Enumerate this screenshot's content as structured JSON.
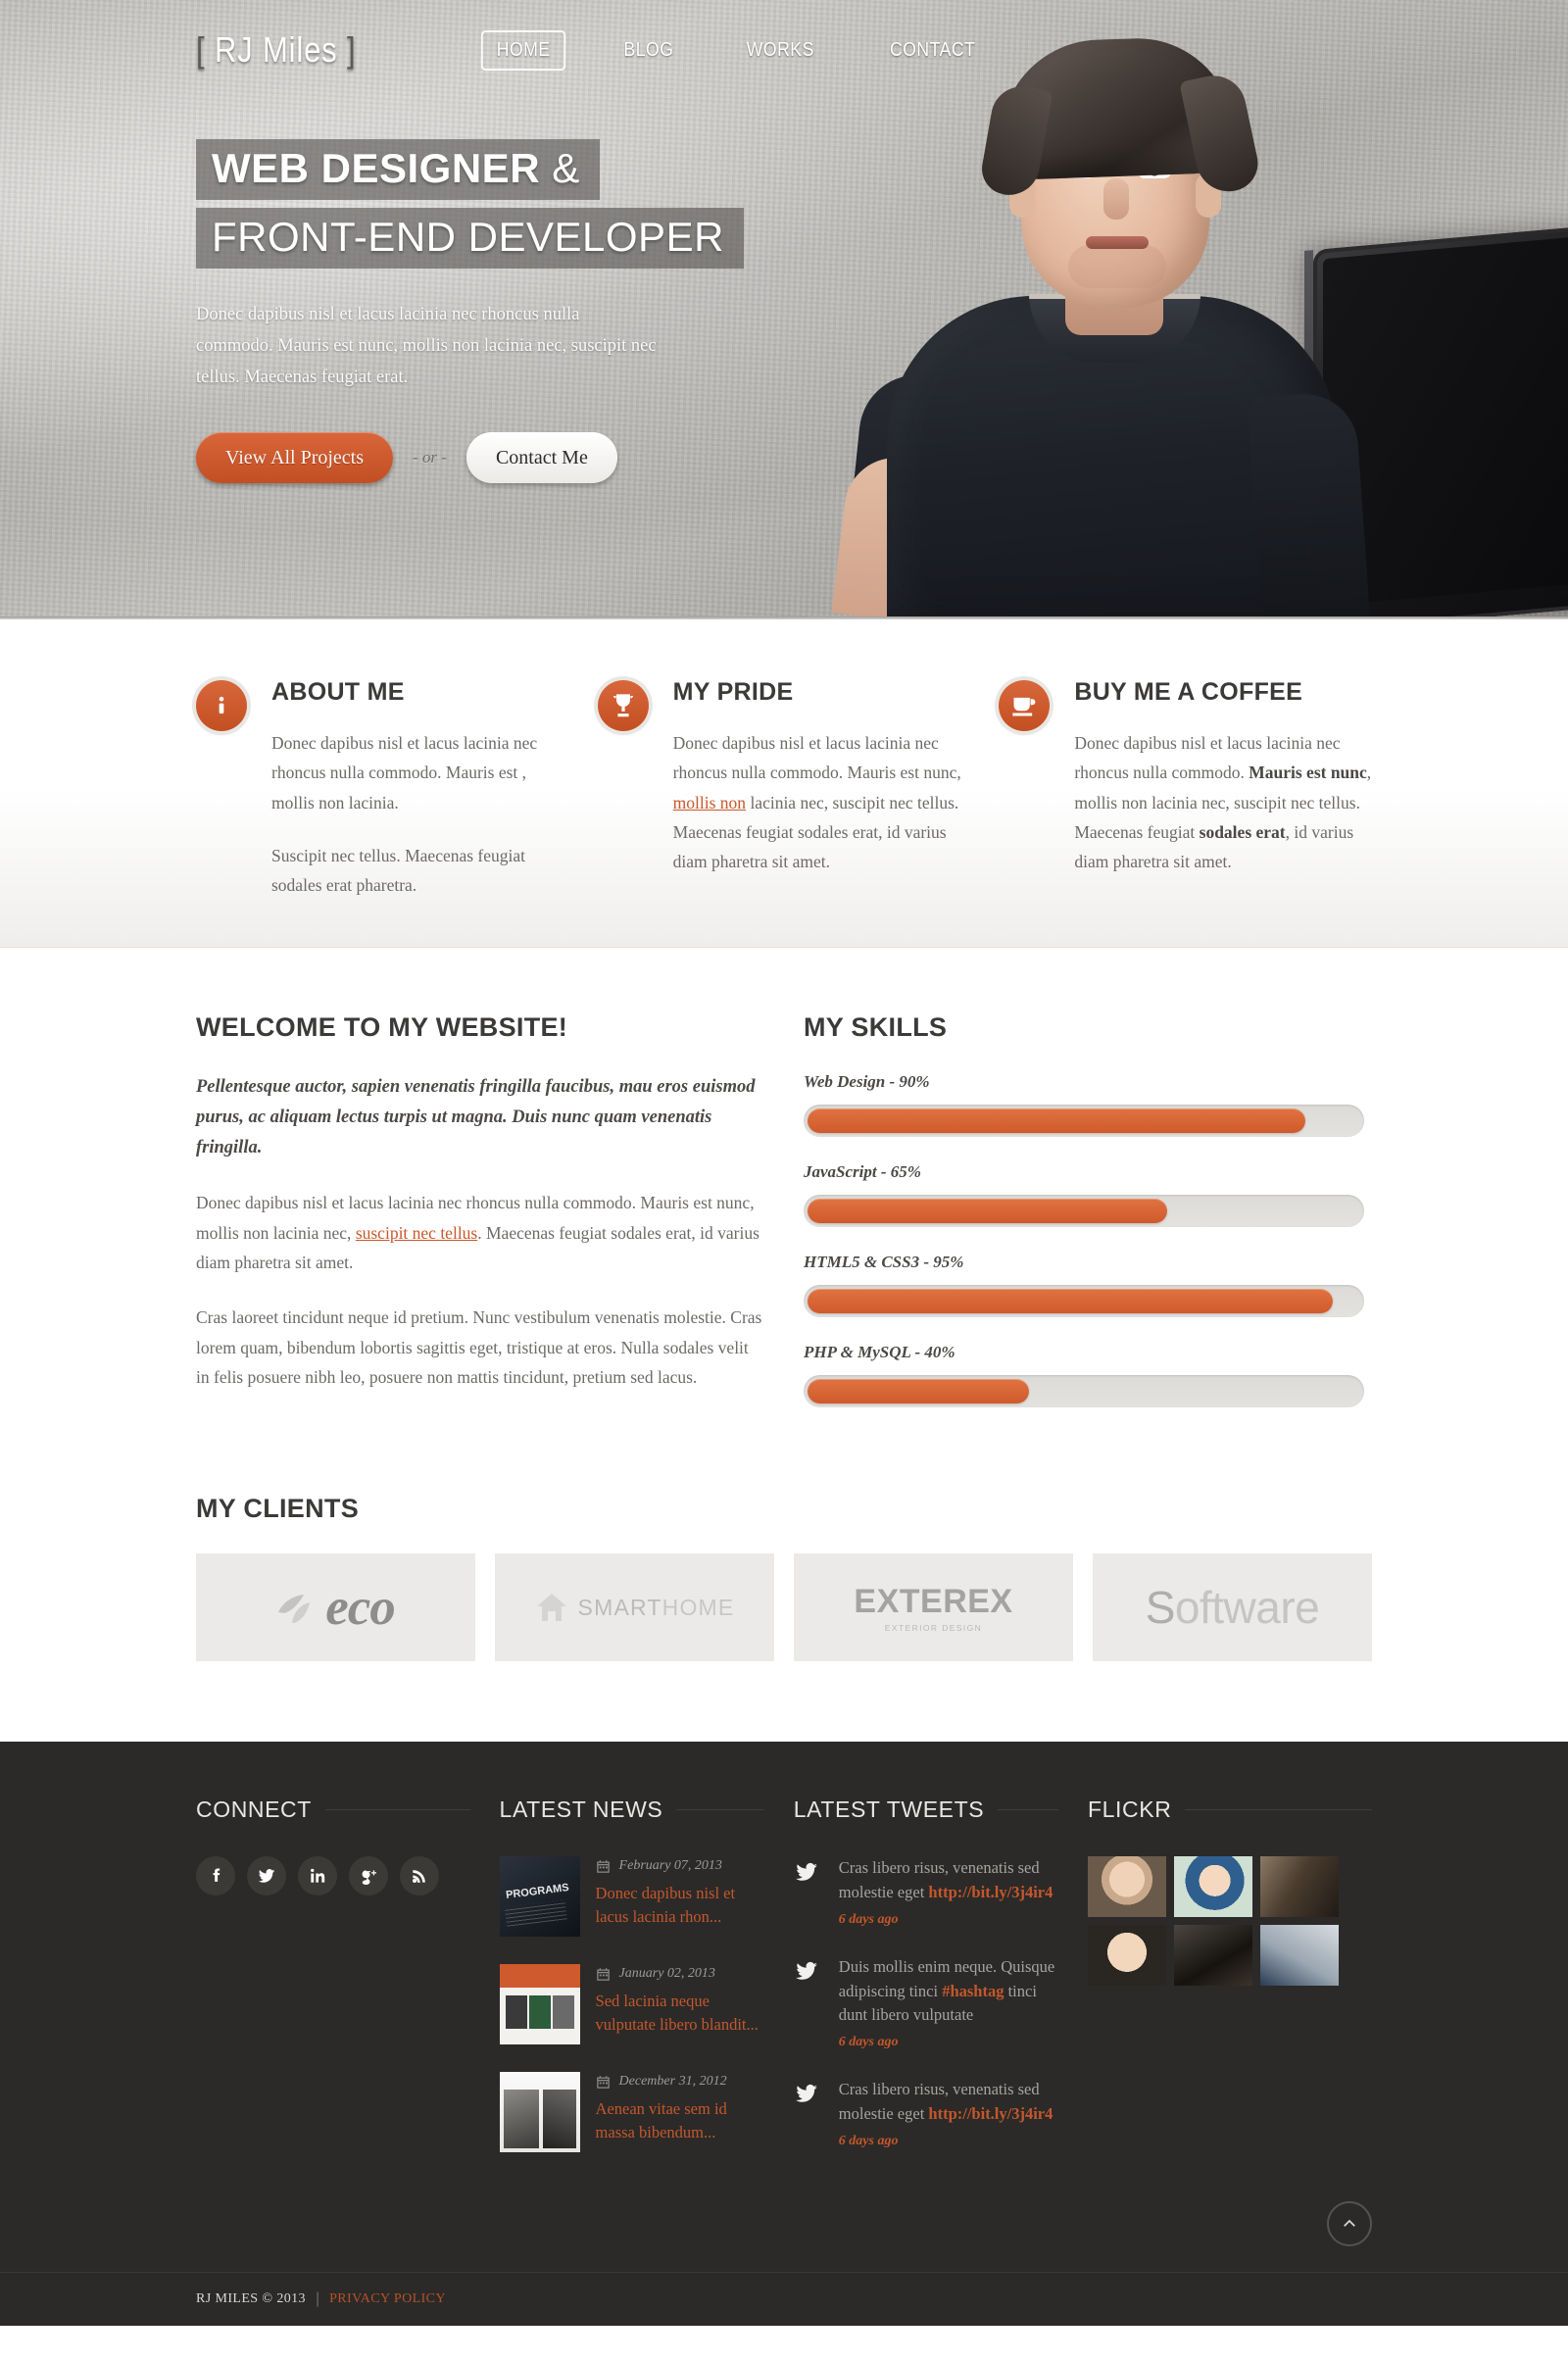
{
  "site": {
    "logo_left_bracket": "[",
    "logo_text": "RJ Miles",
    "logo_right_bracket": "]"
  },
  "nav": {
    "items": [
      {
        "label": "HOME",
        "active": true
      },
      {
        "label": "BLOG",
        "active": false
      },
      {
        "label": "WORKS",
        "active": false
      },
      {
        "label": "CONTACT",
        "active": false
      }
    ]
  },
  "hero": {
    "headline_line1": "WEB DESIGNER",
    "headline_amp": "&",
    "headline_line2": "FRONT-END DEVELOPER",
    "paragraph": "Donec dapibus nisl et lacus lacinia nec rhoncus nulla commodo. Mauris est nunc, mollis non lacinia nec, suscipit nec tellus. Maecenas feugiat erat.",
    "primary_button": "View All Projects",
    "or_text": "- or -",
    "secondary_button": "Contact Me"
  },
  "features": [
    {
      "icon": "info-icon",
      "title": "ABOUT ME",
      "paragraph1_a": "Donec dapibus nisl et lacus lacinia nec rhoncus nulla commodo. Mauris est , mollis non lacinia.",
      "paragraph2": "Suscipit nec tellus. Maecenas feugiat sodales erat pharetra."
    },
    {
      "icon": "trophy-icon",
      "title": "MY PRIDE",
      "paragraph1_a": "Donec dapibus nisl et lacus lacinia nec rhoncus nulla commodo. Mauris est nunc, ",
      "link": "mollis non",
      "paragraph1_b": " lacinia nec, suscipit nec tellus. Maecenas feugiat sodales erat, id varius diam pharetra sit amet."
    },
    {
      "icon": "coffee-icon",
      "title": "BUY ME A COFFEE",
      "paragraph1_a": "Donec dapibus nisl et lacus lacinia nec rhoncus nulla commodo. ",
      "bold1": "Mauris est nunc",
      "paragraph1_b": ", mollis non lacinia nec, suscipit nec tellus. Maecenas feugiat ",
      "bold2": "sodales erat",
      "paragraph1_c": ", id varius diam pharetra sit amet."
    }
  ],
  "welcome": {
    "title": "WELCOME TO MY WEBSITE!",
    "lead": "Pellentesque auctor, sapien venenatis fringilla faucibus, mau eros euismod purus, ac aliquam lectus turpis ut magna. Duis nunc quam venenatis fringilla.",
    "p2_a": "Donec dapibus nisl et lacus lacinia nec rhoncus nulla commodo. Mauris est nunc, mollis non lacinia nec, ",
    "p2_link": "suscipit nec tellus",
    "p2_b": ". Maecenas feugiat sodales erat, id varius diam pharetra sit amet.",
    "p3": "Cras laoreet tincidunt neque id pretium. Nunc vestibulum venenatis molestie. Cras lorem quam, bibendum lobortis sagittis eget, tristique at eros. Nulla sodales velit in felis posuere nibh leo, posuere non mattis tincidunt, pretium sed lacus."
  },
  "skills": {
    "title": "MY SKILLS",
    "items": [
      {
        "label": "Web Design - 90%",
        "value": 90
      },
      {
        "label": "JavaScript - 65%",
        "value": 65
      },
      {
        "label": "HTML5 & CSS3 - 95%",
        "value": 95
      },
      {
        "label": "PHP & MySQL - 40%",
        "value": 40
      }
    ]
  },
  "clients": {
    "title": "MY CLIENTS",
    "logos": [
      {
        "name": "eco",
        "text": "eco"
      },
      {
        "name": "smarthome",
        "text_bold": "SMART",
        "text_light": "HOME"
      },
      {
        "name": "exterex",
        "text": "EXTEREX",
        "sub": "EXTERIOR DESIGN"
      },
      {
        "name": "software",
        "text_a": "S",
        "text_b": "oftware"
      }
    ]
  },
  "footer": {
    "connect": {
      "title": "CONNECT",
      "socials": [
        "facebook-icon",
        "twitter-icon",
        "linkedin-icon",
        "googleplus-icon",
        "rss-icon"
      ]
    },
    "news": {
      "title": "LATEST NEWS",
      "items": [
        {
          "date": "February 07, 2013",
          "title": "Donec dapibus nisl et lacus lacinia rhon..."
        },
        {
          "date": "January 02, 2013",
          "title": "Sed lacinia neque vulputate libero blandit..."
        },
        {
          "date": "December 31, 2012",
          "title": "Aenean vitae sem id massa bibendum..."
        }
      ]
    },
    "tweets": {
      "title": "LATEST TWEETS",
      "items": [
        {
          "text_a": "Cras libero risus, venenatis sed molestie eget ",
          "link": "http://bit.ly/3j4ir4",
          "text_b": "",
          "time": "6 days ago"
        },
        {
          "text_a": "Duis mollis enim neque. Quisque adipiscing tinci ",
          "link": "#hashtag",
          "text_b": " tinci dunt libero vulputate",
          "time": "6 days ago"
        },
        {
          "text_a": "Cras libero risus, venenatis sed molestie eget ",
          "link": "http://bit.ly/3j4ir4",
          "text_b": "",
          "time": "6 days ago"
        }
      ]
    },
    "flickr": {
      "title": "FLICKR",
      "photo_count": 6
    },
    "to_top": "chevron-up-icon",
    "copyright": "RJ MILES © 2013",
    "separator": "|",
    "privacy": "PRIVACY POLICY"
  }
}
